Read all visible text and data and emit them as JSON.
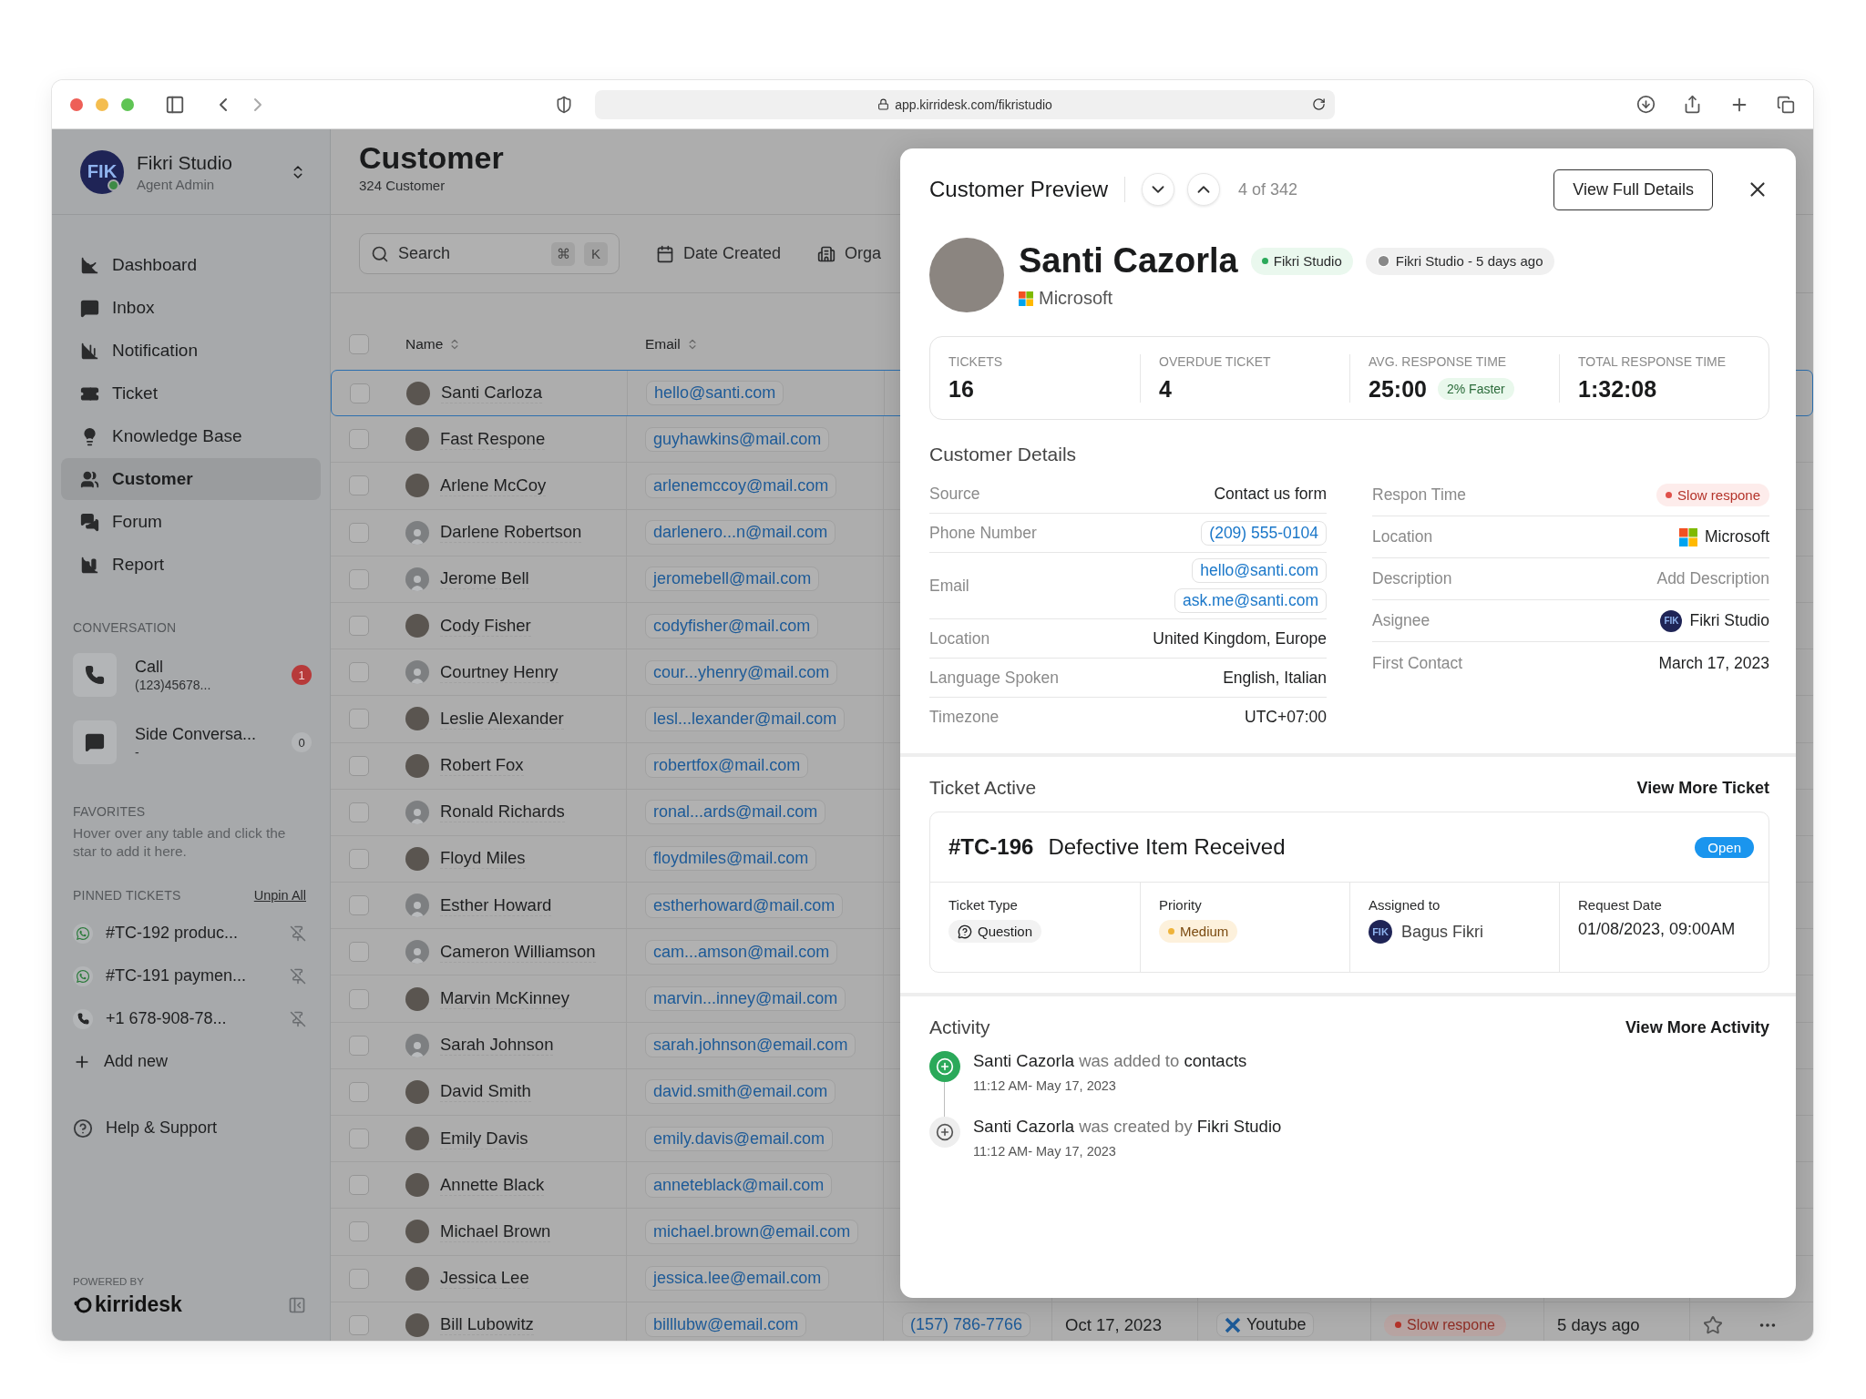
{
  "browser": {
    "url": "app.kirridesk.com/fikristudio"
  },
  "sidebar": {
    "workspace": {
      "avatar": "FIK",
      "name": "Fikri Studio",
      "role": "Agent Admin",
      "online": true
    },
    "nav": [
      {
        "label": "Dashboard",
        "selected": false
      },
      {
        "label": "Inbox",
        "selected": false
      },
      {
        "label": "Notification",
        "selected": false
      },
      {
        "label": "Ticket",
        "selected": false
      },
      {
        "label": "Knowledge Base",
        "selected": false
      },
      {
        "label": "Customer",
        "selected": true
      },
      {
        "label": "Forum",
        "selected": false
      },
      {
        "label": "Report",
        "selected": false
      }
    ],
    "conversation": {
      "title": "CONVERSATION",
      "items": [
        {
          "kind": "call",
          "title": "Call",
          "subtitle": "(123)45678...",
          "badge": "1",
          "unread": true
        },
        {
          "kind": "chat",
          "title": "Side Conversa...",
          "subtitle": "-",
          "badge": "0",
          "unread": false
        }
      ]
    },
    "favorites": {
      "title": "FAVORITES",
      "hint": "Hover over any table and click the star to add it here."
    },
    "pinned": {
      "title": "PINNED TICKETS",
      "action": "Unpin All",
      "items": [
        {
          "kind": "whatsapp",
          "label": "#TC-192 produc..."
        },
        {
          "kind": "whatsapp",
          "label": "#TC-191 paymen..."
        },
        {
          "kind": "call",
          "label": "+1 678-908-78..."
        }
      ]
    },
    "add_new": "Add new",
    "help": "Help & Support",
    "powered_by": "POWERED BY",
    "brand": "kirridesk"
  },
  "main": {
    "title": "Customer",
    "count": "324 Customer",
    "toolbar": {
      "search": {
        "placeholder": "Search",
        "keys": [
          "⌘",
          "K"
        ]
      },
      "filters": [
        {
          "kind": "date",
          "label": "Date Created"
        },
        {
          "kind": "org",
          "label": "Orga"
        }
      ]
    },
    "table": {
      "all_checked": false,
      "columns": [
        {
          "label": "Name"
        },
        {
          "label": "Email"
        }
      ],
      "rows": [
        {
          "name": "Santi Carloza",
          "email": "hello@santi.com",
          "kind": "photo",
          "checked": false,
          "selected": true
        },
        {
          "name": "Fast Respone",
          "email": "guyhawkins@mail.com",
          "kind": "photo",
          "checked": false,
          "selected": false
        },
        {
          "name": "Arlene McCoy",
          "email": "arlenemccoy@mail.com",
          "kind": "photo",
          "checked": false,
          "selected": false
        },
        {
          "name": "Darlene Robertson",
          "email": "darlenero...n@mail.com",
          "kind": "default",
          "checked": false,
          "selected": false
        },
        {
          "name": "Jerome Bell",
          "email": "jeromebell@mail.com",
          "kind": "default",
          "checked": false,
          "selected": false
        },
        {
          "name": "Cody Fisher",
          "email": "codyfisher@mail.com",
          "kind": "photo",
          "checked": false,
          "selected": false
        },
        {
          "name": "Courtney Henry",
          "email": "cour...yhenry@mail.com",
          "kind": "default",
          "checked": false,
          "selected": false
        },
        {
          "name": "Leslie Alexander",
          "email": "lesl...lexander@mail.com",
          "kind": "photo",
          "checked": false,
          "selected": false
        },
        {
          "name": "Robert Fox",
          "email": "robertfox@mail.com",
          "kind": "photo",
          "checked": false,
          "selected": false
        },
        {
          "name": "Ronald Richards",
          "email": "ronal...ards@mail.com",
          "kind": "default",
          "checked": false,
          "selected": false
        },
        {
          "name": "Floyd Miles",
          "email": "floydmiles@mail.com",
          "kind": "photo",
          "checked": false,
          "selected": false
        },
        {
          "name": "Esther Howard",
          "email": "estherhoward@mail.com",
          "kind": "default",
          "checked": false,
          "selected": false
        },
        {
          "name": "Cameron Williamson",
          "email": "cam...amson@mail.com",
          "kind": "default",
          "checked": false,
          "selected": false
        },
        {
          "name": "Marvin McKinney",
          "email": "marvin...inney@mail.com",
          "kind": "photo",
          "checked": false,
          "selected": false
        },
        {
          "name": "Sarah Johnson",
          "email": "sarah.johnson@email.com",
          "kind": "default",
          "checked": false,
          "selected": false
        },
        {
          "name": "David Smith",
          "email": "david.smith@email.com",
          "kind": "photo",
          "checked": false,
          "selected": false
        },
        {
          "name": "Emily Davis",
          "email": "emily.davis@email.com",
          "kind": "photo",
          "checked": false,
          "selected": false
        },
        {
          "name": "Annette Black",
          "email": "anneteblack@mail.com",
          "kind": "photo",
          "checked": false,
          "selected": false
        },
        {
          "name": "Michael Brown",
          "email": "michael.brown@email.com",
          "kind": "photo",
          "checked": false,
          "selected": false
        },
        {
          "name": "Jessica Lee",
          "email": "jessica.lee@email.com",
          "kind": "photo",
          "checked": false,
          "selected": false
        },
        {
          "name": "Bill Lubowitz",
          "email": "billlubw@email.com",
          "kind": "photo",
          "checked": false,
          "selected": false,
          "phone": "(157) 786-7766",
          "date": "Oct 17, 2023",
          "source": "Youtube",
          "status": "Slow respone",
          "last_seen": "5 days ago",
          "starred": false
        }
      ]
    }
  },
  "preview": {
    "title": "Customer Preview",
    "position": "4 of 342",
    "full_details": "View Full Details",
    "customer": {
      "name": "Santi Cazorla",
      "company": "Microsoft",
      "tags": [
        {
          "kind": "status",
          "label": "Fikri Studio"
        },
        {
          "kind": "time",
          "label": "Fikri Studio - 5 days ago"
        }
      ]
    },
    "stats": [
      {
        "label": "TICKETS",
        "value": "16"
      },
      {
        "label": "OVERDUE TICKET",
        "value": "4"
      },
      {
        "label": "AVG. RESPONSE TIME",
        "value": "25:00",
        "badge": "2% Faster"
      },
      {
        "label": "TOTAL RESPONSE TIME",
        "value": "1:32:08"
      }
    ],
    "details_title": "Customer Details",
    "details_left": [
      {
        "label": "Source",
        "kind": "text",
        "values": [
          "Contact us form"
        ]
      },
      {
        "label": "Phone Number",
        "kind": "link",
        "values": [
          "(209) 555-0104"
        ]
      },
      {
        "label": "Email",
        "kind": "link",
        "values": [
          "hello@santi.com",
          "ask.me@santi.com"
        ]
      },
      {
        "label": "Location",
        "kind": "text",
        "values": [
          "United Kingdom, Europe"
        ]
      },
      {
        "label": "Language Spoken",
        "kind": "text",
        "values": [
          "English, Italian"
        ]
      },
      {
        "label": "Timezone",
        "kind": "text",
        "values": [
          "UTC+07:00"
        ]
      }
    ],
    "details_right": [
      {
        "label": "Respon Time",
        "kind": "alert",
        "values": [
          "Slow respone"
        ]
      },
      {
        "label": "Location",
        "kind": "company",
        "values": [
          "Microsoft"
        ]
      },
      {
        "label": "Description",
        "kind": "placeholder",
        "values": [
          "Add Description"
        ]
      },
      {
        "label": "Asignee",
        "kind": "agent",
        "avatar": "FIK",
        "values": [
          "Fikri Studio"
        ]
      },
      {
        "label": "First Contact",
        "kind": "text",
        "values": [
          "March 17, 2023"
        ]
      }
    ],
    "ticket": {
      "title": "Ticket Active",
      "more": "View More Ticket",
      "id": "#TC-196",
      "subject": "Defective Item Received",
      "status": "Open",
      "fields": [
        {
          "kind": "type",
          "label": "Ticket Type",
          "value": "Question"
        },
        {
          "kind": "priority",
          "label": "Priority",
          "value": "Medium"
        },
        {
          "kind": "agent",
          "label": "Assigned to",
          "avatar": "FIK",
          "value": "Bagus Fikri"
        },
        {
          "kind": "text",
          "label": "Request Date",
          "value": "01/08/2023, 09:00AM"
        }
      ]
    },
    "activity": {
      "title": "Activity",
      "more": "View More Activity",
      "items": [
        {
          "text": "**Santi Cazorla** was added to **contacts**",
          "time": "11:12 AM- May 17, 2023",
          "latest": true
        },
        {
          "text": "**Santi Cazorla** was created by **Fikri Studio**",
          "time": "11:12 AM- May 17, 2023",
          "latest": false
        }
      ]
    }
  }
}
